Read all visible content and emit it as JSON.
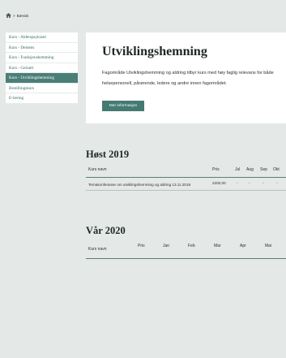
{
  "breadcrumb": {
    "home_icon": "home-icon",
    "separator": ">",
    "current": "Bæsisk"
  },
  "sidebar": {
    "items": [
      {
        "label": "Kurs - Alderspsykiatri",
        "active": false
      },
      {
        "label": "Kurs - Demens",
        "active": false
      },
      {
        "label": "Kurs - Funksjonshemming",
        "active": false
      },
      {
        "label": "Kurs - Geriatri",
        "active": false
      },
      {
        "label": "Kurs - Utviklingshemming",
        "active": true
      },
      {
        "label": "Bestillingskurs",
        "active": false
      },
      {
        "label": "E-læring",
        "active": false
      }
    ]
  },
  "hero": {
    "title": "Utviklingshemning",
    "body": "Fagområde Utviklingshemming og aldring tilbyr kurs med høy faglig relevans for både helsepersonell, pårørende, ledere og andre innen fagområdet.",
    "button_label": "Mer informasjon"
  },
  "autumn": {
    "title": "Høst 2019",
    "headers": {
      "name": "Kurs navn",
      "price": "Pris",
      "jul": "Jul",
      "aug": "Aug",
      "sep": "Sep",
      "okt": "Okt"
    },
    "rows": [
      {
        "name": "Temakonferanse om utviklingshemming og aldring 13.11.2019",
        "price": "2200,00",
        "jul": "-",
        "aug": "-",
        "sep": "-",
        "okt": "-"
      }
    ]
  },
  "spring": {
    "title": "Vår 2020",
    "headers": {
      "name": "Kurs navn",
      "price": "Pris",
      "jan": "Jan",
      "feb": "Feb",
      "mar": "Mar",
      "apr": "Apr",
      "mai": "Mai"
    }
  },
  "colors": {
    "accent": "#447a72",
    "active_bg": "#4a7f78",
    "link": "#2e6b62",
    "background": "#e4e8e6"
  }
}
